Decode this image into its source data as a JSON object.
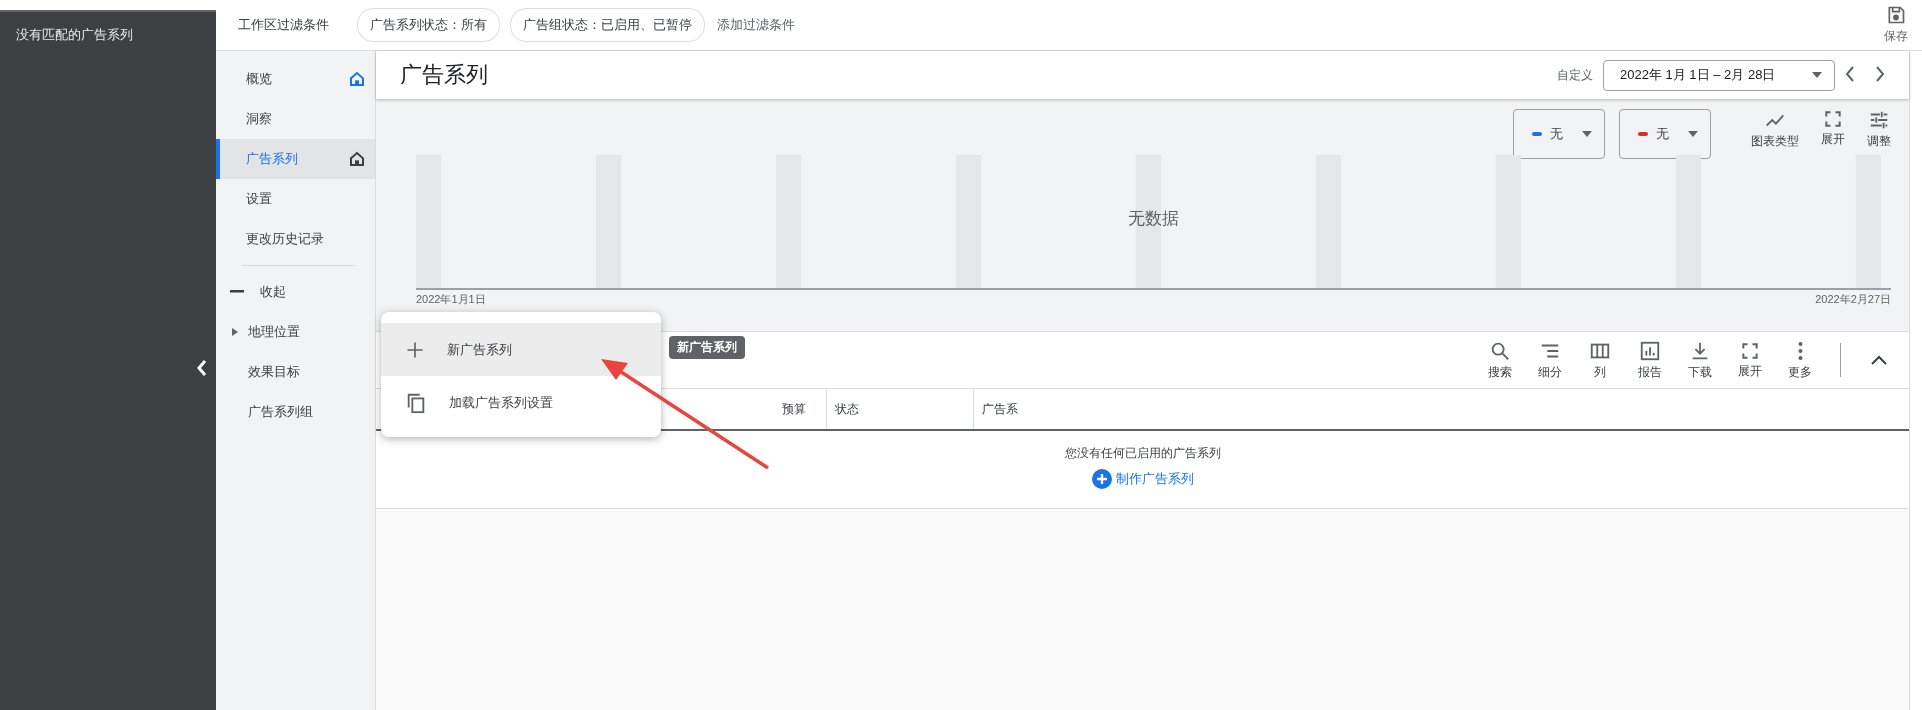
{
  "sidebar": {
    "message": "没有匹配的广告系列"
  },
  "filter_bar": {
    "label": "工作区过滤条件",
    "chips": [
      "广告系列状态：所有",
      "广告组状态：已启用、已暂停"
    ],
    "add_filter": "添加过滤条件",
    "save": "保存"
  },
  "nav": {
    "items": [
      {
        "label": "概览",
        "selected": false,
        "pinned": true
      },
      {
        "label": "洞察",
        "selected": false,
        "pinned": false
      },
      {
        "label": "广告系列",
        "selected": true,
        "pinned": true
      },
      {
        "label": "设置",
        "selected": false,
        "pinned": false
      },
      {
        "label": "更改历史记录",
        "selected": false,
        "pinned": false
      }
    ],
    "sections": [
      {
        "kind": "collapse",
        "label": "收起"
      },
      {
        "kind": "expandable",
        "label": "地理位置"
      },
      {
        "kind": "plain",
        "label": "效果目标"
      },
      {
        "kind": "plain",
        "label": "广告系列组"
      }
    ]
  },
  "page": {
    "title": "广告系列",
    "date_label": "自定义",
    "date_range": "2022年 1月 1日 – 2月 28日"
  },
  "chart": {
    "metrics": [
      {
        "label": "无",
        "color": "#1a73e8"
      },
      {
        "label": "无",
        "color": "#d93025"
      }
    ],
    "tools": [
      {
        "kind": "line",
        "label": "图表类型"
      },
      {
        "kind": "expand",
        "label": "展开"
      },
      {
        "kind": "tune",
        "label": "调整"
      }
    ],
    "empty_text": "无数据",
    "start_label": "2022年1月1日",
    "end_label": "2022年2月27日"
  },
  "table": {
    "tools": [
      {
        "kind": "search",
        "label": "搜索"
      },
      {
        "kind": "segment",
        "label": "细分"
      },
      {
        "kind": "columns",
        "label": "列"
      },
      {
        "kind": "report",
        "label": "报告"
      },
      {
        "kind": "download",
        "label": "下载"
      },
      {
        "kind": "expand",
        "label": "展开"
      },
      {
        "kind": "more",
        "label": "更多"
      }
    ],
    "columns": [
      "预算",
      "状态",
      "广告系"
    ],
    "empty_text": "您没有任何已启用的广告系列",
    "create_link": "制作广告系列"
  },
  "menu": {
    "items": [
      {
        "kind": "add",
        "label": "新广告系列",
        "selected": true
      },
      {
        "kind": "copy",
        "label": "加载广告系列设置",
        "selected": false
      }
    ]
  },
  "tooltip": "新广告系列"
}
